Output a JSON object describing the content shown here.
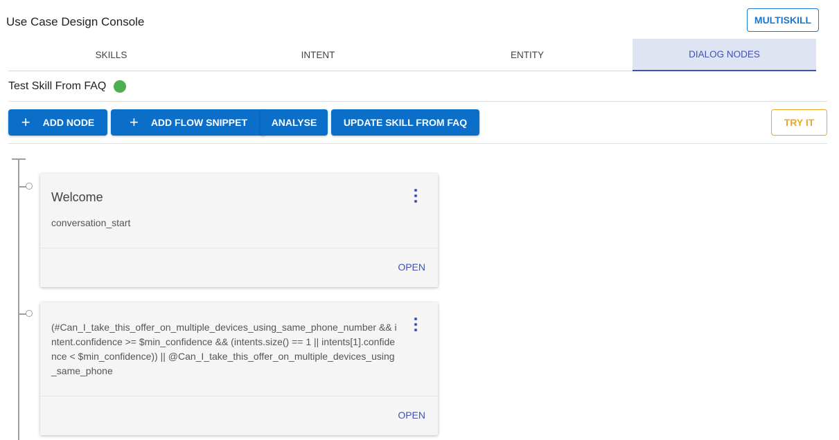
{
  "app": {
    "title": "Use Case Design Console",
    "multiskill_label": "MULTISKILL"
  },
  "tabs": [
    {
      "label": "SKILLS"
    },
    {
      "label": "INTENT"
    },
    {
      "label": "ENTITY"
    },
    {
      "label": "DIALOG NODES",
      "active": true
    }
  ],
  "skill": {
    "name": "Test Skill From FAQ",
    "status_color": "#4caf50"
  },
  "toolbar": {
    "add_node_label": "ADD NODE",
    "add_flow_snippet_label": "ADD FLOW SNIPPET",
    "analyse_label": "ANALYSE",
    "update_skill_label": "UPDATE SKILL FROM FAQ",
    "try_it_label": "TRY IT",
    "plus_icon": "+"
  },
  "nodes": [
    {
      "title": "Welcome",
      "condition": "conversation_start",
      "open_label": "OPEN"
    },
    {
      "title": "",
      "condition": "(#Can_I_take_this_offer_on_multiple_devices_using_same_phone_number && intent.confidence >= $min_confidence && (intents.size() == 1 || intents[1].confidence < $min_confidence)) || @Can_I_take_this_offer_on_multiple_devices_using_same_phone",
      "open_label": "OPEN"
    }
  ],
  "colors": {
    "primary": "#0b6ec9",
    "accent": "#3f51b5",
    "try_it": "#f0a520",
    "status_ok": "#4caf50"
  }
}
